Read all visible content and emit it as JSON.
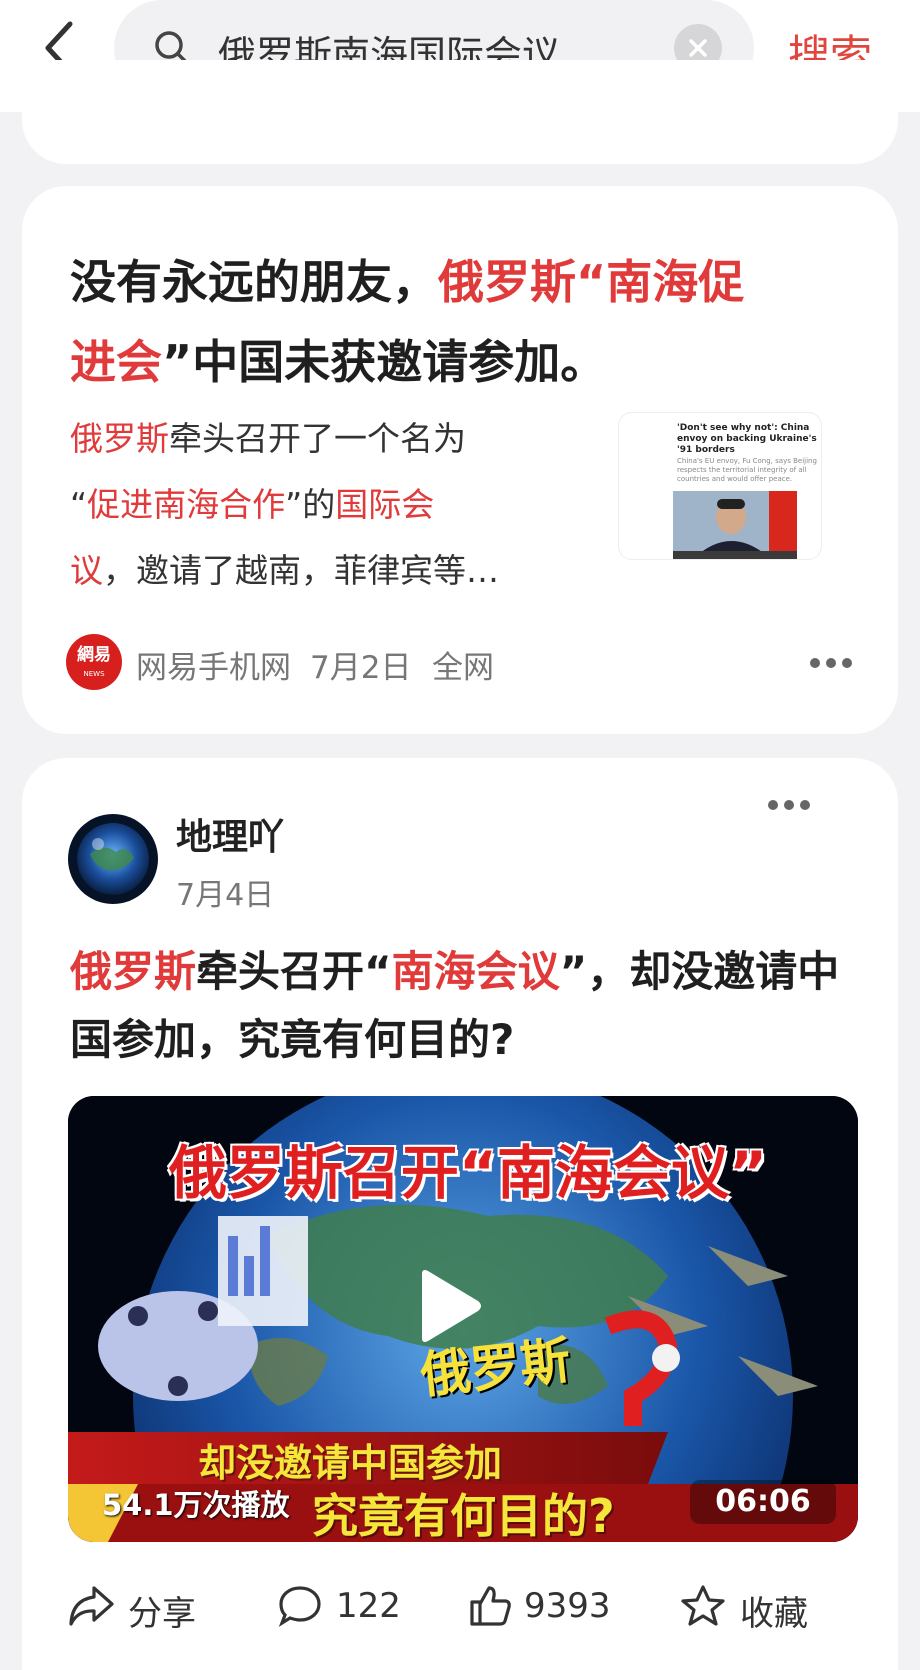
{
  "search": {
    "query": "俄罗斯南海国际会议",
    "button_label": "搜索"
  },
  "card1": {
    "title_parts": [
      "没有永远的朋友，",
      "俄罗斯",
      "“",
      "南海促",
      "进会",
      "”中国未获邀请参加。"
    ],
    "snippet_parts": [
      "俄罗斯",
      "牵头召开了一个名为",
      "“",
      "促进南海合作",
      "”的",
      "国际会",
      "议",
      "，邀请了越南，菲律宾等…"
    ],
    "thumbnail": {
      "headline": "'Don't see why not': China envoy on backing Ukraine's '91 borders",
      "subtext": "China's EU envoy, Fu Cong, says Beijing respects the territorial integrity of all countries and would offer peace."
    },
    "source_logo": {
      "line1": "網易",
      "line2": "NEWS"
    },
    "source": "网易手机网",
    "date": "7月2日",
    "scope": "全网"
  },
  "card2": {
    "author": "地理吖",
    "date": "7月4日",
    "title_parts": [
      "俄罗斯",
      "牵头召开“",
      "南海会议",
      "”，却没邀请中国参加，究竟有何目的?"
    ],
    "video": {
      "headline": "俄罗斯召开“南海会议”",
      "country_label": "俄罗斯",
      "banner_line1": "却没邀请中国参加",
      "banner_line2": "究竟有何目的?",
      "views": "54.1万次播放",
      "duration": "06:06"
    },
    "actions": {
      "share": "分享",
      "comments": "122",
      "likes": "9393",
      "favorite": "收藏"
    }
  },
  "colors": {
    "accent": "#e03a3a",
    "page_bg": "#f2f2f5"
  }
}
